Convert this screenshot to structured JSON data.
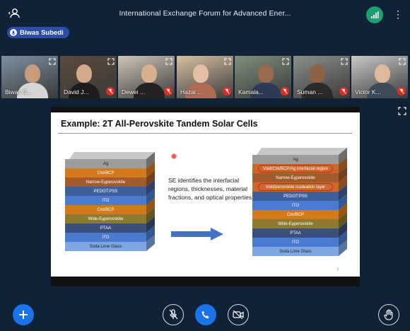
{
  "meeting": {
    "title": "International Exchange Forum for Advanced Ener..."
  },
  "presenter": {
    "name": "Biwas Subedi"
  },
  "participants": [
    {
      "name": "Biwas S...",
      "skin": "#c89b7b",
      "bg": "#7d8fa3",
      "shirt": "#d6d6d6"
    },
    {
      "name": "David J...",
      "skin": "#d2a98a",
      "bg": "#5a4a3b",
      "shirt": "#1c1c1c"
    },
    {
      "name": "Dewei ...",
      "skin": "#d8b090",
      "bg": "#cfc6b8",
      "shirt": "#222"
    },
    {
      "name": "Hazal ...",
      "skin": "#e4bfa6",
      "bg": "#d9c0a1",
      "shirt": "#b06b55"
    },
    {
      "name": "Kamala...",
      "skin": "#9a6a4e",
      "bg": "#7f8f7c",
      "shirt": "#2d3a55"
    },
    {
      "name": "Suman ...",
      "skin": "#8d6245",
      "bg": "#8c8f8c",
      "shirt": "#2a2a2a"
    },
    {
      "name": "Victor K...",
      "skin": "#e0b99c",
      "bg": "#c9c9c9",
      "shirt": "#3c4a5a"
    }
  ],
  "slide": {
    "title": "Example: 2T All-Perovskite Tandem Solar Cells",
    "note": "SE identifies the interfacial regions, thicknesses, material fractions, and optical properties",
    "page": "7",
    "left_stack": [
      "Ag",
      "C60/BCP",
      "Narrow-Eg perovskite",
      "PEDOT:PSS",
      "ITO",
      "C60/BCP",
      "Wide-Eg perovskite",
      "PTAA",
      "ITO",
      "Soda Lime Glass"
    ],
    "right_stack": [
      "Ag",
      "Void/C60/BCP/Ag interfacial region",
      "Narrow-Eg perovskite",
      "Void/perovskite nucleation layer",
      "PEDOT:PSS",
      "ITO",
      "C60/BCP",
      "Wide-Eg perovskite",
      "PTAA",
      "ITO",
      "Soda Lime Glass"
    ]
  },
  "colors": {
    "accent": "#1a73e8",
    "background": "#0f2238",
    "mute_red": "#d93025",
    "signal_green": "#1e9f6f"
  }
}
